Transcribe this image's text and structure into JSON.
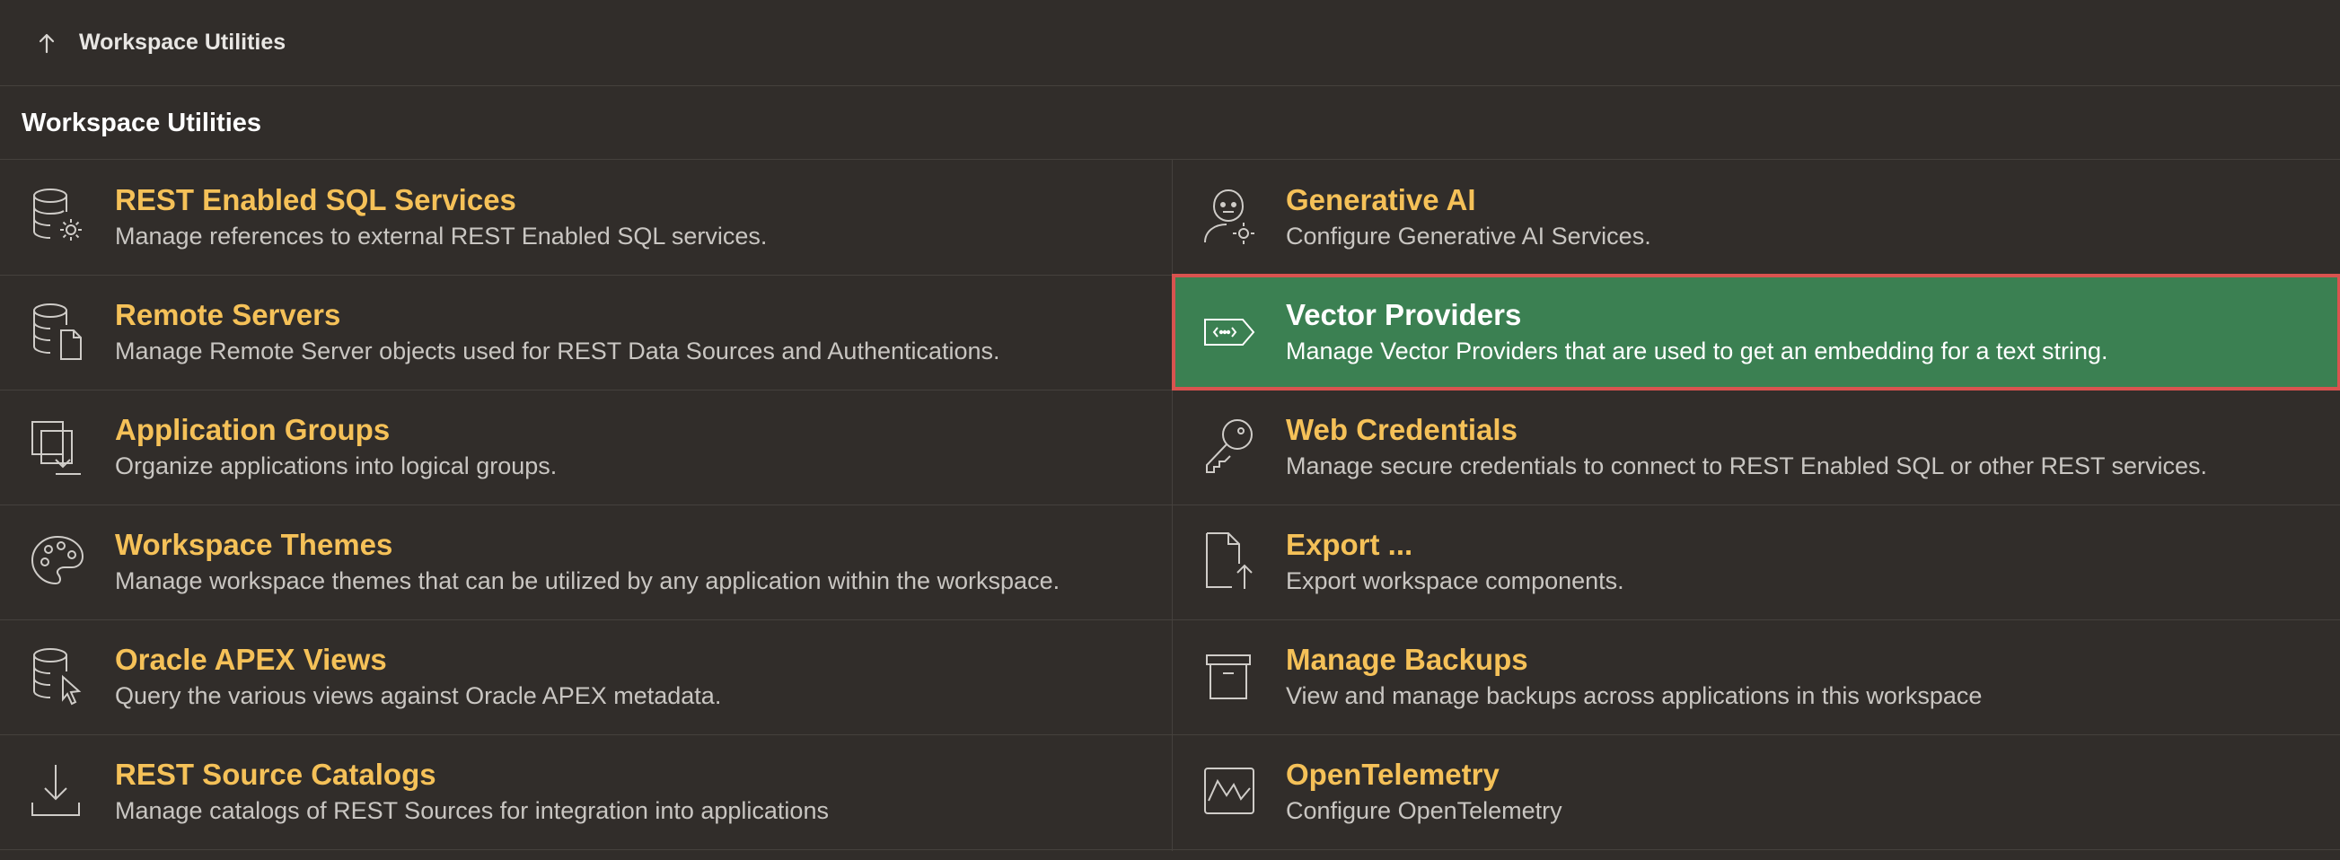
{
  "breadcrumb": {
    "up_icon": "arrow-up-icon",
    "label": "Workspace Utilities"
  },
  "region": {
    "title": "Workspace Utilities"
  },
  "colors": {
    "background": "#312d2a",
    "title_accent": "#f5c158",
    "active_background": "#3b8052",
    "active_outline": "#d9534f"
  },
  "cards": [
    {
      "title": "REST Enabled SQL Services",
      "description": "Manage references to external REST Enabled SQL services.",
      "icon": "database-gear-icon",
      "active": false
    },
    {
      "title": "Generative AI",
      "description": "Configure Generative AI Services.",
      "icon": "robot-gear-icon",
      "active": false
    },
    {
      "title": "Remote Servers",
      "description": "Manage Remote Server objects used for REST Data Sources and Authentications.",
      "icon": "database-document-icon",
      "active": false
    },
    {
      "title": "Vector Providers",
      "description": "Manage Vector Providers that are used to get an embedding for a text string.",
      "icon": "vector-tag-icon",
      "active": true
    },
    {
      "title": "Application Groups",
      "description": "Organize applications into logical groups.",
      "icon": "copy-download-icon",
      "active": false
    },
    {
      "title": "Web Credentials",
      "description": "Manage secure credentials to connect to REST Enabled SQL or other REST services.",
      "icon": "key-icon",
      "active": false
    },
    {
      "title": "Workspace Themes",
      "description": "Manage workspace themes that can be utilized by any application within the workspace.",
      "icon": "palette-icon",
      "active": false
    },
    {
      "title": "Export ...",
      "description": "Export workspace components.",
      "icon": "file-export-icon",
      "active": false
    },
    {
      "title": "Oracle APEX Views",
      "description": "Query the various views against Oracle APEX metadata.",
      "icon": "database-cursor-icon",
      "active": false
    },
    {
      "title": "Manage Backups",
      "description": "View and manage backups across applications in this workspace",
      "icon": "archive-box-icon",
      "active": false
    },
    {
      "title": "REST Source Catalogs",
      "description": "Manage catalogs of REST Sources for integration into applications",
      "icon": "download-tray-icon",
      "active": false
    },
    {
      "title": "OpenTelemetry",
      "description": "Configure OpenTelemetry",
      "icon": "activity-chart-icon",
      "active": false
    }
  ]
}
